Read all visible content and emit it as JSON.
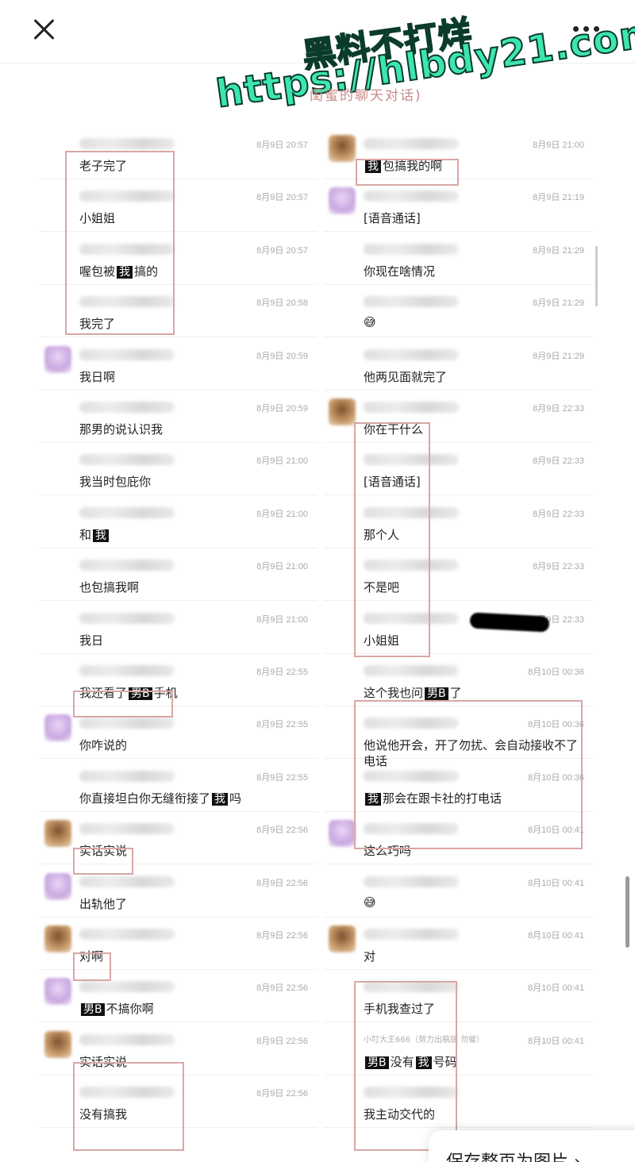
{
  "topbar": {
    "close_icon": "close-icon",
    "more_icon": "more-icon"
  },
  "watermark": {
    "line1": "黑料不打烊",
    "line2": "https://hlbdy21.com"
  },
  "subtitle": "闺蜜的聊天对话)",
  "left_messages": [
    {
      "time": "8月9日 20:57",
      "text": "老子完了"
    },
    {
      "time": "8月9日 20:57",
      "text": "小姐姐"
    },
    {
      "time": "8月9日 20:57",
      "text_pre": "喔包被",
      "tag": "我",
      "text_post": "搞的"
    },
    {
      "time": "8月9日 20:58",
      "text": "我完了"
    },
    {
      "time": "8月9日 20:59",
      "text": "我日啊",
      "avatar": "purple"
    },
    {
      "time": "8月9日 20:59",
      "text": "那男的说认识我"
    },
    {
      "time": "8月9日 21:00",
      "text": "我当时包庇你"
    },
    {
      "time": "8月9日 21:00",
      "text_pre": "和",
      "tag": "我",
      "text_post": ""
    },
    {
      "time": "8月9日 21:00",
      "text": "也包搞我啊"
    },
    {
      "time": "8月9日 21:00",
      "text": "我日"
    },
    {
      "time": "8月9日 22:55",
      "text_pre": "我还看了",
      "tag": "男B",
      "text_post": "手机"
    },
    {
      "time": "8月9日 22:55",
      "text": "你咋说的",
      "avatar": "purple"
    },
    {
      "time": "8月9日 22:55",
      "text_pre": "你直接坦白你无缝衔接了",
      "tag": "我",
      "text_post": "吗"
    },
    {
      "time": "8月9日 22:56",
      "text": "实话实说",
      "avatar": "brown"
    },
    {
      "time": "8月9日 22:56",
      "text": "出轨他了",
      "avatar": "purple"
    },
    {
      "time": "8月9日 22:56",
      "text": "对啊",
      "avatar": "brown"
    },
    {
      "time": "8月9日 22:56",
      "text_pre": "",
      "tag": "男B",
      "text_post": "不搞你啊",
      "avatar": "purple"
    },
    {
      "time": "8月9日 22:56",
      "text": "实话实说",
      "avatar": "brown"
    },
    {
      "time": "8月9日 22:56",
      "text": "没有搞我"
    }
  ],
  "right_messages": [
    {
      "time": "8月9日 21:00",
      "text_pre": "",
      "tag": "我",
      "text_post": "包搞我的啊",
      "avatar": "brown"
    },
    {
      "time": "8月9日 21:19",
      "text": "[语音通话]",
      "avatar": "purple"
    },
    {
      "time": "8月9日 21:29",
      "text": "你现在啥情况"
    },
    {
      "time": "8月9日 21:29",
      "text": "😅"
    },
    {
      "time": "8月9日 21:29",
      "text": "他两见面就完了"
    },
    {
      "time": "8月9日 22:33",
      "text": "你在干什么",
      "avatar": "brown"
    },
    {
      "time": "8月9日 22:33",
      "text": "[语音通话]"
    },
    {
      "time": "8月9日 22:33",
      "text": "那个人"
    },
    {
      "time": "8月9日 22:33",
      "text": "不是吧"
    },
    {
      "time": "8月9日 22:33",
      "text": "小姐姐"
    },
    {
      "time": "8月10日 00:36",
      "text_pre": "这个我也问",
      "tag": "男B",
      "text_post": "了"
    },
    {
      "time": "8月10日 00:36",
      "text": "他说他开会，开了勿扰、会自动接收不了",
      "text2": "电话"
    },
    {
      "time": "8月10日 00:36",
      "text_pre": "",
      "tag": "我",
      "text_post": "那会在跟卡社的打电话"
    },
    {
      "time": "8月10日 00:41",
      "text": "这么巧吗",
      "avatar": "purple"
    },
    {
      "time": "8月10日 00:41",
      "text": "😅"
    },
    {
      "time": "8月10日 00:41",
      "text": "对",
      "avatar": "brown"
    },
    {
      "time": "8月10日 00:41",
      "text": "手机我查过了"
    },
    {
      "time": "8月10日 00:41",
      "name": "小叮大王666（努力出稿版 勿催）",
      "text_pre": "",
      "tag": "男B",
      "text_mid": "没有",
      "tag2": "我",
      "text_post": "号码"
    },
    {
      "time": "",
      "text": "我主动交代的"
    }
  ],
  "save_button": {
    "label": "保存整页为图片 ›"
  }
}
